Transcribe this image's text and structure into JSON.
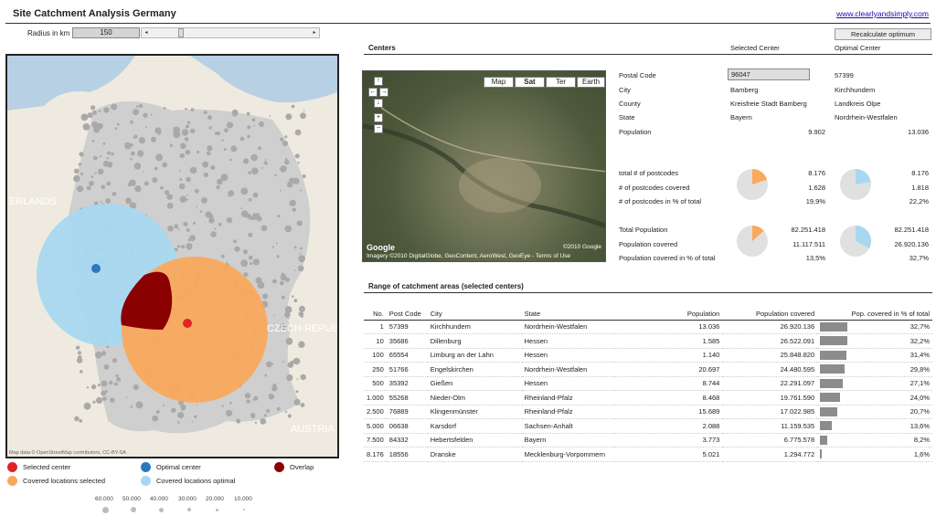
{
  "app": {
    "title": "Site Catchment Analysis Germany",
    "link": "www.clearlyandsimply.com"
  },
  "radius": {
    "label": "Radius in km",
    "value": "150",
    "slider_pos": 0.18
  },
  "map": {
    "attribution": "Map data © OpenStreetMap contributors, CC-BY-SA",
    "places": [
      "ERLANDS",
      "CZECH REPUB",
      "AUSTRIA"
    ]
  },
  "legend": {
    "items": [
      {
        "label": "Selected center",
        "color": "#e02424"
      },
      {
        "label": "Optimal center",
        "color": "#2b78be"
      },
      {
        "label": "Overlap",
        "color": "#8b0000"
      },
      {
        "label": "Covered locations selected",
        "color": "#f9a95c"
      },
      {
        "label": "Covered locations optimal",
        "color": "#a8d8f0"
      }
    ],
    "scale": [
      "60.000",
      "50.000",
      "40.000",
      "30.000",
      "20.000",
      "10.000"
    ]
  },
  "centers": {
    "header": "Centers",
    "col_selected": "Selected Center",
    "col_optimal": "Optimal Center",
    "recalc_label": "Recalculate  optimum",
    "fields": [
      {
        "label": "Postal Code",
        "selected": "96047",
        "optimal": "57399"
      },
      {
        "label": "City",
        "selected": "Bamberg",
        "optimal": "Kirchhundem"
      },
      {
        "label": "County",
        "selected": "Kreisfreie Stadt Bamberg",
        "optimal": "Landkreis Olpe"
      },
      {
        "label": "State",
        "selected": "Bayern",
        "optimal": "Nordrhein-Westfalen"
      },
      {
        "label": "Population",
        "selected": "9.902",
        "optimal": "13.036"
      }
    ],
    "stats1": [
      {
        "label": "total # of postcodes",
        "selected": "8.176",
        "optimal": "8.176"
      },
      {
        "label": "# of postcodes covered",
        "selected": "1.628",
        "optimal": "1.818"
      },
      {
        "label": "# of postcodes in % of total",
        "selected": "19,9%",
        "optimal": "22,2%"
      }
    ],
    "stats2": [
      {
        "label": "Total Population",
        "selected": "82.251.418",
        "optimal": "82.251.418"
      },
      {
        "label": "Population covered",
        "selected": "11.117.511",
        "optimal": "26.920.136"
      },
      {
        "label": "Population covered in % of total",
        "selected": "13,5%",
        "optimal": "32,7%"
      }
    ],
    "pie_fractions": {
      "postcodes_selected": 0.199,
      "postcodes_optimal": 0.222,
      "pop_selected": 0.135,
      "pop_optimal": 0.327
    },
    "pie_colors": {
      "selected": "#f9a95c",
      "optimal": "#a8d8f0",
      "rest": "#e0e0e0"
    }
  },
  "satellite": {
    "map_types": [
      "Map",
      "Sat",
      "Ter",
      "Earth"
    ],
    "active": "Sat",
    "nav": [
      "↑",
      "←",
      "→",
      "↓",
      "+",
      "−"
    ],
    "imagery": "Imagery ©2010 DigitalGlobe, GeoContent, AeroWest, GeoEye - Terms of Use",
    "google": "Google",
    "copyright": "©2010 Google"
  },
  "range": {
    "header": "Range of catchment areas (selected centers)",
    "columns": [
      "No.",
      "Post Code",
      "City",
      "State",
      "Population",
      "Population covered",
      "Pop. covered in % of total"
    ],
    "rows": [
      {
        "no": "1",
        "pc": "57399",
        "city": "Kirchhundem",
        "state": "Nordrhein-Westfalen",
        "pop": "13.036",
        "covered": "26.920.136",
        "pct": "32,7%",
        "frac": 0.327
      },
      {
        "no": "10",
        "pc": "35686",
        "city": "Dillenburg",
        "state": "Hessen",
        "pop": "1.585",
        "covered": "26.522.091",
        "pct": "32,2%",
        "frac": 0.322
      },
      {
        "no": "100",
        "pc": "65554",
        "city": "Limburg an der Lahn",
        "state": "Hessen",
        "pop": "1.140",
        "covered": "25.848.820",
        "pct": "31,4%",
        "frac": 0.314
      },
      {
        "no": "250",
        "pc": "51766",
        "city": "Engelskirchen",
        "state": "Nordrhein-Westfalen",
        "pop": "20.697",
        "covered": "24.480.595",
        "pct": "29,8%",
        "frac": 0.298
      },
      {
        "no": "500",
        "pc": "35392",
        "city": "Gießen",
        "state": "Hessen",
        "pop": "8.744",
        "covered": "22.291.097",
        "pct": "27,1%",
        "frac": 0.271
      },
      {
        "no": "1.000",
        "pc": "55268",
        "city": "Nieder-Olm",
        "state": "Rheinland-Pfalz",
        "pop": "8.468",
        "covered": "19.761.590",
        "pct": "24,0%",
        "frac": 0.24
      },
      {
        "no": "2.500",
        "pc": "76889",
        "city": "Klingenmünster",
        "state": "Rheinland-Pfalz",
        "pop": "15.689",
        "covered": "17.022.985",
        "pct": "20,7%",
        "frac": 0.207
      },
      {
        "no": "5.000",
        "pc": "06638",
        "city": "Karsdorf",
        "state": "Sachsen-Anhalt",
        "pop": "2.088",
        "covered": "11.159.535",
        "pct": "13,6%",
        "frac": 0.136
      },
      {
        "no": "7.500",
        "pc": "84332",
        "city": "Hebertsfelden",
        "state": "Bayern",
        "pop": "3.773",
        "covered": "6.775.578",
        "pct": "8,2%",
        "frac": 0.082
      },
      {
        "no": "8.176",
        "pc": "18556",
        "city": "Dranske",
        "state": "Mecklenburg-Vorpommern",
        "pop": "5.021",
        "covered": "1.294.772",
        "pct": "1,6%",
        "frac": 0.016
      }
    ]
  }
}
